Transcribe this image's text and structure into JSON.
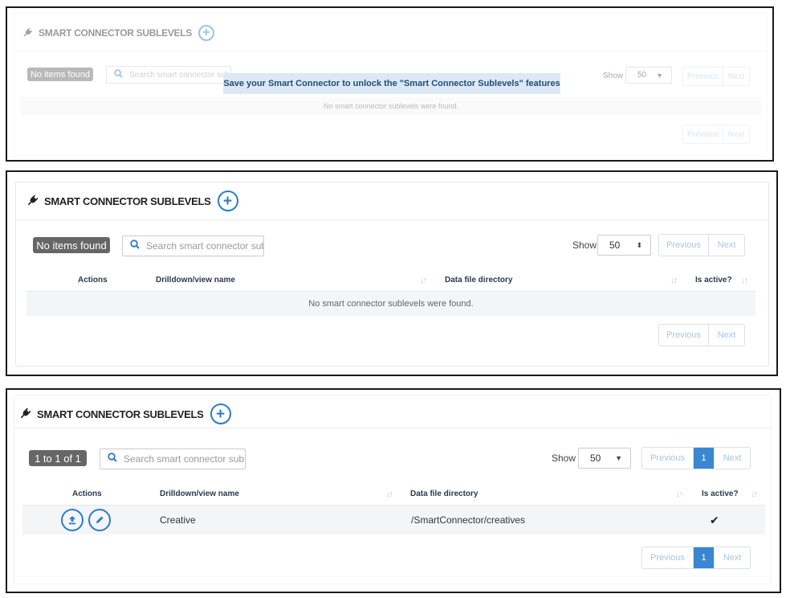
{
  "panels": [
    {
      "title": "SMART CONNECTOR SUBLEVELS",
      "badge": "No items found",
      "search_placeholder": "Search smart connector sub",
      "show_label": "Show",
      "page_size": "50",
      "prev_label": "Previous",
      "next_label": "Next",
      "empty_message": "No smart connector sublevels were found.",
      "tooltip": "Save your Smart Connector to unlock the \"Smart Connector Sublevels\" features"
    },
    {
      "title": "SMART CONNECTOR SUBLEVELS",
      "badge": "No items found",
      "search_placeholder": "Search smart connector sub",
      "show_label": "Show",
      "page_size": "50",
      "prev_label": "Previous",
      "next_label": "Next",
      "columns": [
        "Actions",
        "Drilldown/view name",
        "Data file directory",
        "Is active?"
      ],
      "empty_message": "No smart connector sublevels were found."
    },
    {
      "title": "SMART CONNECTOR SUBLEVELS",
      "badge": "1 to 1 of 1",
      "search_placeholder": "Search smart connector sub",
      "show_label": "Show",
      "page_size": "50",
      "prev_label": "Previous",
      "page_number": "1",
      "next_label": "Next",
      "columns": [
        "Actions",
        "Drilldown/view name",
        "Data file directory",
        "Is active?"
      ],
      "rows": [
        {
          "name": "Creative",
          "directory": "/SmartConnector/creatives",
          "active": "✔"
        }
      ]
    }
  ],
  "icons": {
    "plug": "plug-icon",
    "add": "plus-circle-icon",
    "search": "search-icon",
    "upload": "upload-icon",
    "edit": "pencil-icon",
    "check": "check-icon"
  },
  "colors": {
    "accent": "#2d7cc4",
    "badge": "#666666",
    "pager_active": "#3b86d0",
    "row_bg": "#f4f5f7",
    "tooltip_bg": "#dce8f3"
  }
}
